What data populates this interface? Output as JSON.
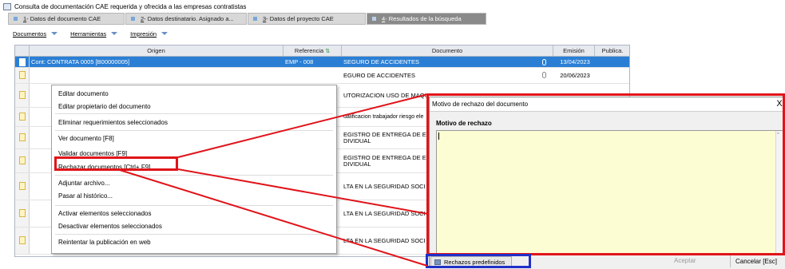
{
  "window": {
    "title": "Consulta de documentación CAE requerida y ofrecida a las empresas contratistas"
  },
  "tabs": [
    {
      "prefix": "",
      "num": "1",
      "label": " - Datos del documento CAE",
      "active": false
    },
    {
      "prefix": "",
      "num": "2",
      "label": " - Datos destinatario. Asignado a...",
      "active": false
    },
    {
      "prefix": "",
      "num": "3",
      "label": " - Datos del proyecto CAE",
      "active": false
    },
    {
      "prefix": "",
      "num": "4",
      "label": " - Resultados de la búsqueda",
      "active": true
    }
  ],
  "toolbar": {
    "documentos": "Documentos",
    "herramientas": "Herramientas",
    "impresion": "Impresión"
  },
  "grid": {
    "columns": {
      "origen": "Origen",
      "referencia": "Referencia",
      "documento": "Documento",
      "emision": "Emisión",
      "publica": "Publica."
    },
    "rows": [
      {
        "origen": "Cont: CONTRATA 0005 [B00000005]",
        "referencia": "EMP - 008",
        "documento": "SEGURO DE ACCIDENTES",
        "emision": "13/04/2023"
      },
      {
        "origen": "",
        "referencia": "",
        "documento": "EGURO DE ACCIDENTES",
        "emision": "20/06/2023"
      },
      {
        "origen": "",
        "referencia": "",
        "documento": "UTORIZACION USO DE MAQU",
        "emision": ""
      },
      {
        "origen": "",
        "referencia": "",
        "documento": "ualificacion trabajador riesgo ele",
        "emision": ""
      },
      {
        "origen": "",
        "referencia": "",
        "documento": "EGISTRO DE ENTREGA DE E\nDIVIDUAL",
        "emision": ""
      },
      {
        "origen": "",
        "referencia": "",
        "documento": "EGISTRO DE ENTREGA DE E\nDIVIDUAL",
        "emision": ""
      },
      {
        "origen": "",
        "referencia": "",
        "documento": "LTA EN LA SEGURIDAD SOCI",
        "emision": ""
      },
      {
        "origen": "",
        "referencia": "",
        "documento": "LTA EN LA SEGURIDAD SOCI",
        "emision": ""
      },
      {
        "origen": "",
        "referencia": "",
        "documento": "LTA EN LA SEGURIDAD SOCI",
        "emision": ""
      }
    ]
  },
  "context_menu": {
    "editar_documento": "Editar documento",
    "editar_propietario": "Editar propietario del documento",
    "eliminar_requerimientos": "Eliminar requerimientos seleccionados",
    "ver_documento": "Ver documento [F8]",
    "validar_documentos": "Validar documentos [F9]",
    "rechazar_documentos": "Rechazar documentos [Ctrl+ F9]",
    "adjuntar_archivo": "Adjuntar archivo...",
    "pasar_historico": "Pasar al histórico...",
    "activar_elementos": "Activar elementos seleccionados",
    "desactivar_elementos": "Desactivar elementos seleccionados",
    "reintentar_publicacion": "Reintentar la publicación en web"
  },
  "dialog": {
    "title": "Motivo de rechazo del documento",
    "close": "X",
    "field_label": "Motivo de rechazo",
    "field_value": "",
    "rechazos_predefinidos": "Rechazos predefinidos",
    "aceptar": "Aceptar",
    "cancelar": "Cancelar [Esc]"
  },
  "colors": {
    "highlight_red": "#e0141a",
    "highlight_blue": "#2030c8",
    "selection": "#2a7fd5",
    "textarea_bg": "#fdfdd4"
  }
}
